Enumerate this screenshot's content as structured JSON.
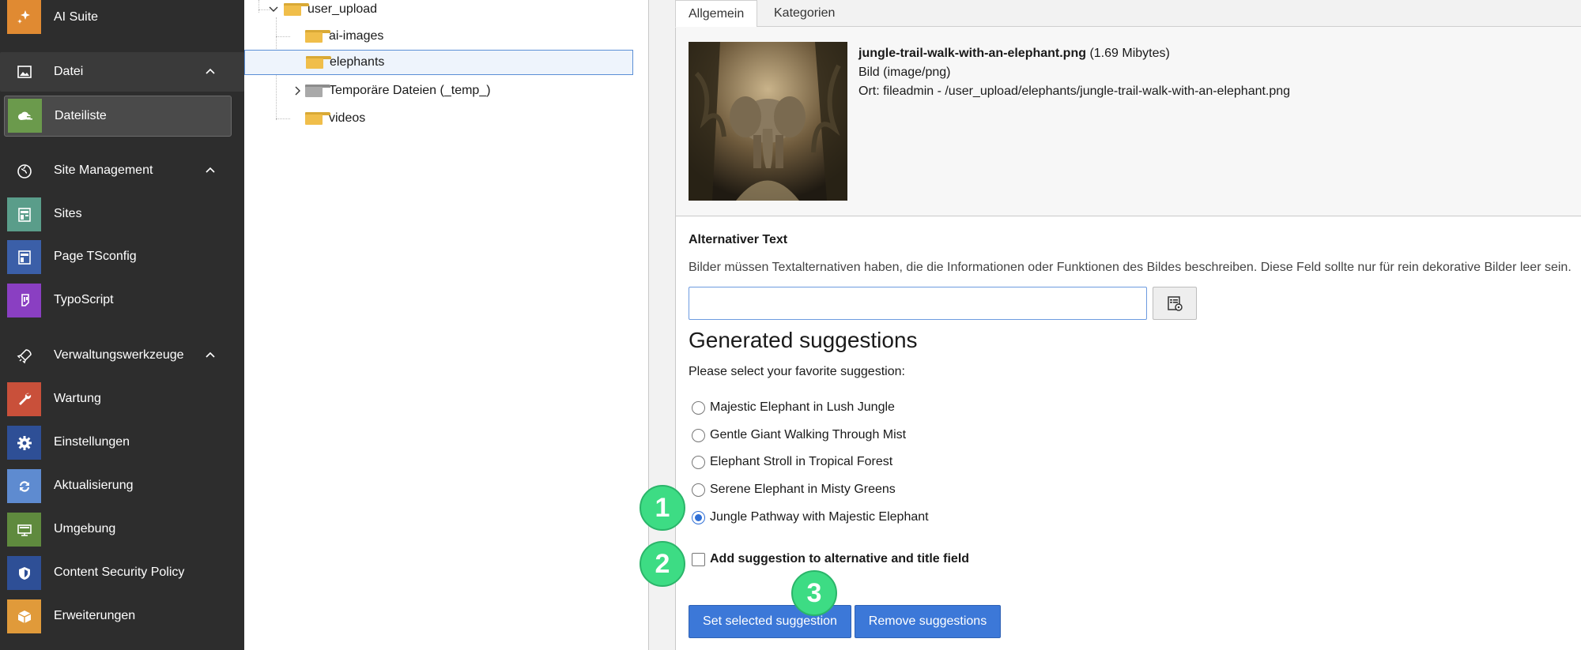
{
  "sidebar": {
    "items": [
      {
        "label": "AI Suite",
        "icon": "sparkle-icon",
        "color": "#e08a32"
      },
      {
        "label": "Datei",
        "icon": "image-icon",
        "group": true
      },
      {
        "label": "Dateiliste",
        "icon": "cloud-list-icon",
        "color": "#6b9a4c",
        "active": true
      },
      {
        "label": "Site Management",
        "icon": "globe-icon",
        "group": true
      },
      {
        "label": "Sites",
        "icon": "sites-icon",
        "color": "#5a9d8a"
      },
      {
        "label": "Page TSconfig",
        "icon": "page-tsconfig-icon",
        "color": "#3b5fa8"
      },
      {
        "label": "TypoScript",
        "icon": "typoscript-icon",
        "color": "#8a3fc2"
      },
      {
        "label": "Verwaltungswerkzeuge",
        "icon": "rocket-icon",
        "group": true
      },
      {
        "label": "Wartung",
        "icon": "wrench-icon",
        "color": "#c9503a"
      },
      {
        "label": "Einstellungen",
        "icon": "gear-icon",
        "color": "#2e4f96"
      },
      {
        "label": "Aktualisierung",
        "icon": "refresh-icon",
        "color": "#5e8bd0"
      },
      {
        "label": "Umgebung",
        "icon": "environment-icon",
        "color": "#5f8a3e"
      },
      {
        "label": "Content Security Policy",
        "icon": "shield-icon",
        "color": "#2e4f96"
      },
      {
        "label": "Erweiterungen",
        "icon": "box-icon",
        "color": "#e09a3a"
      }
    ]
  },
  "tree": {
    "items": [
      {
        "label": "user_upload"
      },
      {
        "label": "ai-images"
      },
      {
        "label": "elephants",
        "selected": true
      },
      {
        "label": "Temporäre Dateien (_temp_)"
      },
      {
        "label": "videos"
      }
    ]
  },
  "tabs": [
    "Allgemein",
    "Kategorien"
  ],
  "file": {
    "name": "jungle-trail-walk-with-an-elephant.png",
    "size": "(1.69 Mibytes)",
    "type": "Bild (image/png)",
    "location": "Ort: fileadmin - /user_upload/elephants/jungle-trail-walk-with-an-elephant.png"
  },
  "alt": {
    "label": "Alternativer Text",
    "description": "Bilder müssen Textalternativen haben, die die Informationen oder Funktionen des Bildes beschreiben. Diese Feld sollte nur für rein dekorative Bilder leer sein.",
    "value": ""
  },
  "suggestions": {
    "title": "Generated suggestions",
    "subtitle": "Please select your favorite suggestion:",
    "options": [
      "Majestic Elephant in Lush Jungle",
      "Gentle Giant Walking Through Mist",
      "Elephant Stroll in Tropical Forest",
      "Serene Elephant in Misty Greens",
      "Jungle Pathway with Majestic Elephant"
    ],
    "selected_index": 4,
    "checkbox_label": "Add suggestion to alternative and title field",
    "set_button": "Set selected suggestion",
    "remove_button": "Remove suggestions"
  },
  "steps": [
    "1",
    "2",
    "3"
  ]
}
